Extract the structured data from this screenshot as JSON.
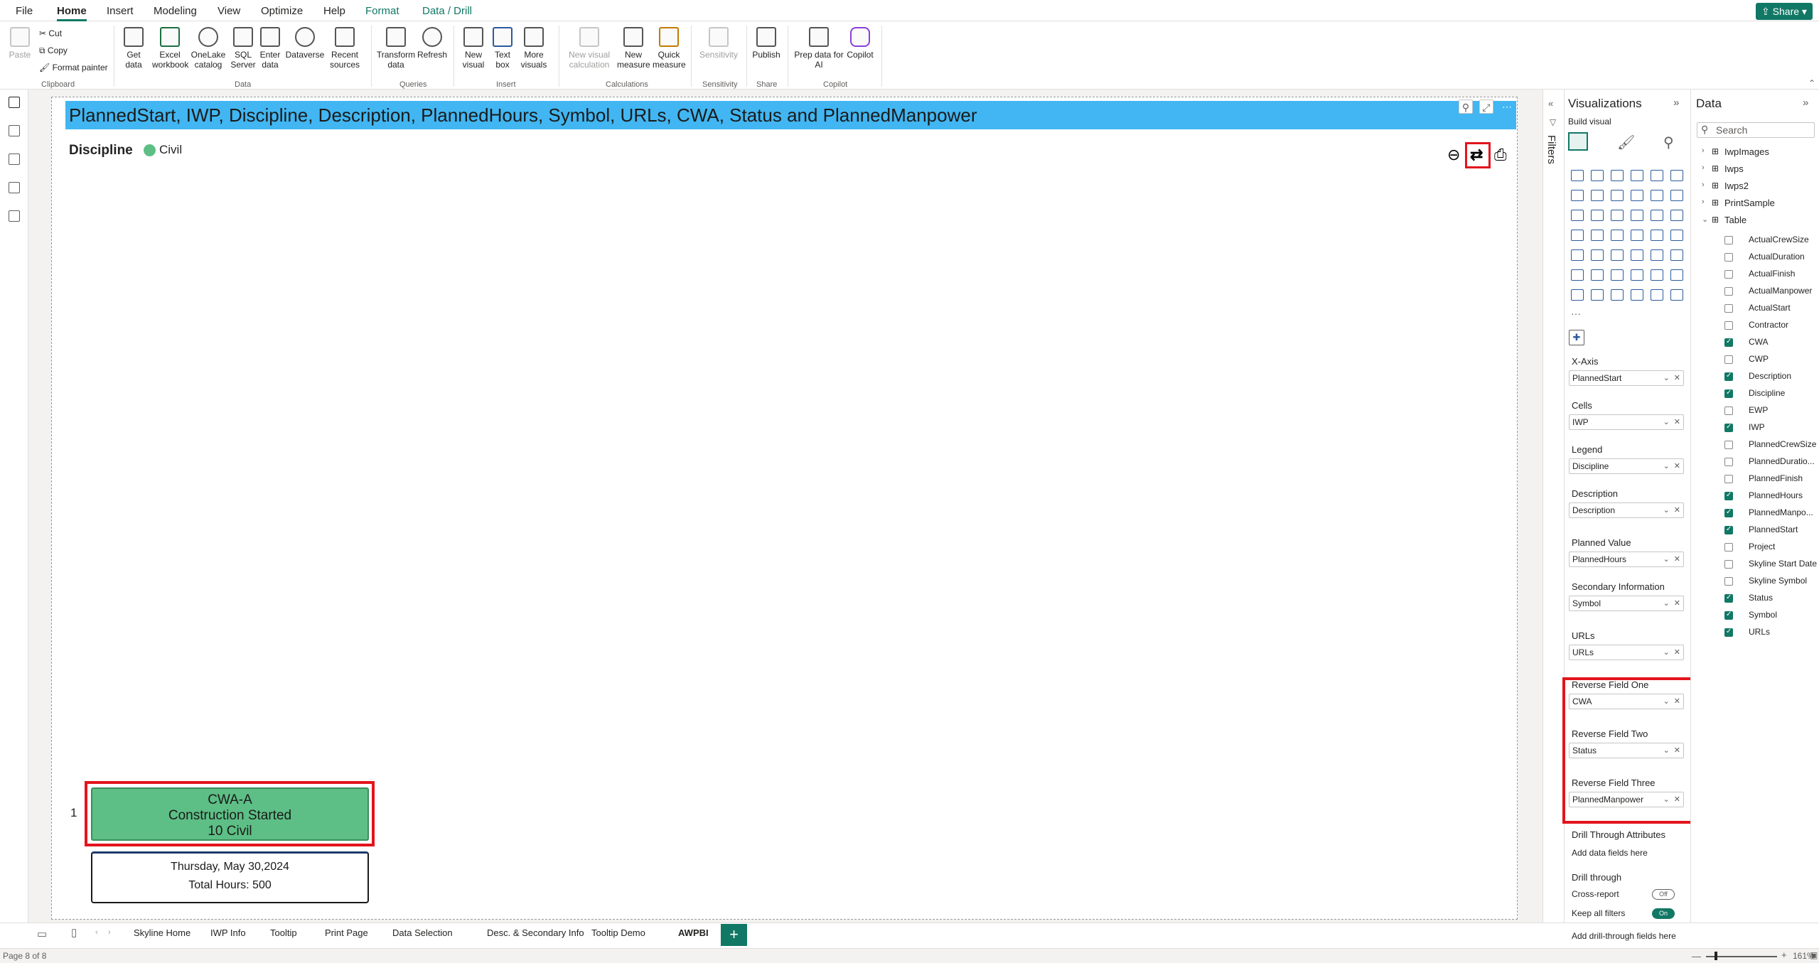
{
  "menu": {
    "tabs": [
      "File",
      "Home",
      "Insert",
      "Modeling",
      "View",
      "Optimize",
      "Help",
      "Format",
      "Data / Drill"
    ],
    "share_label": "Share"
  },
  "ribbon": {
    "clipboard": {
      "paste": "Paste",
      "cut": "Cut",
      "copy": "Copy",
      "format_painter": "Format painter",
      "group": "Clipboard"
    },
    "data": {
      "get_data": "Get data",
      "excel": "Excel workbook",
      "onelake": "OneLake catalog",
      "sql": "SQL Server",
      "enter": "Enter data",
      "dataverse": "Dataverse",
      "recent": "Recent sources",
      "group": "Data"
    },
    "queries": {
      "transform": "Transform data",
      "refresh": "Refresh",
      "group": "Queries"
    },
    "insert": {
      "new_visual": "New visual",
      "text_box": "Text box",
      "more_visuals": "More visuals",
      "group": "Insert"
    },
    "calculations": {
      "new_visual_calc": "New visual calculation",
      "new_measure": "New measure",
      "quick_measure": "Quick measure",
      "group": "Calculations"
    },
    "sensitivity": {
      "label": "Sensitivity",
      "group": "Sensitivity"
    },
    "share": {
      "publish": "Publish",
      "group": "Share"
    },
    "copilot": {
      "prep": "Prep data for AI",
      "copilot": "Copilot",
      "group": "Copilot"
    }
  },
  "visual": {
    "title": "PlannedStart, IWP, Discipline, Description, PlannedHours, Symbol, URLs, CWA, Status and PlannedManpower",
    "legend_title": "Discipline",
    "legend_item": "Civil",
    "row_number": "1",
    "card": {
      "line1": "CWA-A",
      "line2": "Construction Started",
      "line3": "10 Civil"
    },
    "detail": {
      "date": "Thursday, May 30,2024",
      "hours": "Total Hours: 500"
    },
    "colors": {
      "title_bar": "#41b6f2",
      "card": "#5dbf85",
      "highlight": "#e3141c"
    }
  },
  "filters": {
    "label": "Filters"
  },
  "viz_pane": {
    "title": "Visualizations",
    "build_visual": "Build visual",
    "wells": [
      {
        "label": "X-Axis",
        "value": "PlannedStart"
      },
      {
        "label": "Cells",
        "value": "IWP"
      },
      {
        "label": "Legend",
        "value": "Discipline"
      },
      {
        "label": "Description",
        "value": "Description"
      },
      {
        "label": "Planned Value",
        "value": "PlannedHours"
      },
      {
        "label": "Secondary Information",
        "value": "Symbol"
      },
      {
        "label": "URLs",
        "value": "URLs"
      },
      {
        "label": "Reverse Field One",
        "value": "CWA"
      },
      {
        "label": "Reverse Field Two",
        "value": "Status"
      },
      {
        "label": "Reverse Field Three",
        "value": "PlannedManpower"
      }
    ],
    "drill_attributes": "Drill Through Attributes",
    "add_data_fields": "Add data fields here",
    "drill_through": "Drill through",
    "cross_report": "Cross-report",
    "cross_report_state": "Off",
    "keep_filters": "Keep all filters",
    "keep_filters_state": "On",
    "add_drill_fields": "Add drill-through fields here"
  },
  "data_pane": {
    "title": "Data",
    "search_placeholder": "Search",
    "tables": [
      "IwpImages",
      "Iwps",
      "Iwps2",
      "PrintSample",
      "Table"
    ],
    "fields": [
      {
        "name": "ActualCrewSize",
        "checked": false
      },
      {
        "name": "ActualDuration",
        "checked": false
      },
      {
        "name": "ActualFinish",
        "checked": false
      },
      {
        "name": "ActualManpower",
        "checked": false
      },
      {
        "name": "ActualStart",
        "checked": false
      },
      {
        "name": "Contractor",
        "checked": false
      },
      {
        "name": "CWA",
        "checked": true
      },
      {
        "name": "CWP",
        "checked": false
      },
      {
        "name": "Description",
        "checked": true
      },
      {
        "name": "Discipline",
        "checked": true
      },
      {
        "name": "EWP",
        "checked": false
      },
      {
        "name": "IWP",
        "checked": true
      },
      {
        "name": "PlannedCrewSize",
        "checked": false
      },
      {
        "name": "PlannedDuratio...",
        "checked": false
      },
      {
        "name": "PlannedFinish",
        "checked": false
      },
      {
        "name": "PlannedHours",
        "checked": true
      },
      {
        "name": "PlannedManpo...",
        "checked": true
      },
      {
        "name": "PlannedStart",
        "checked": true
      },
      {
        "name": "Project",
        "checked": false
      },
      {
        "name": "Skyline Start Date",
        "checked": false
      },
      {
        "name": "Skyline Symbol",
        "checked": false
      },
      {
        "name": "Status",
        "checked": true
      },
      {
        "name": "Symbol",
        "checked": true
      },
      {
        "name": "URLs",
        "checked": true
      }
    ]
  },
  "pages": [
    "Skyline Home",
    "IWP Info",
    "Tooltip",
    "Print Page",
    "Data Selection",
    "Desc. & Secondary Info",
    "Tooltip Demo",
    "AWPBI"
  ],
  "status": {
    "page": "Page 8 of 8",
    "zoom": "161%"
  }
}
